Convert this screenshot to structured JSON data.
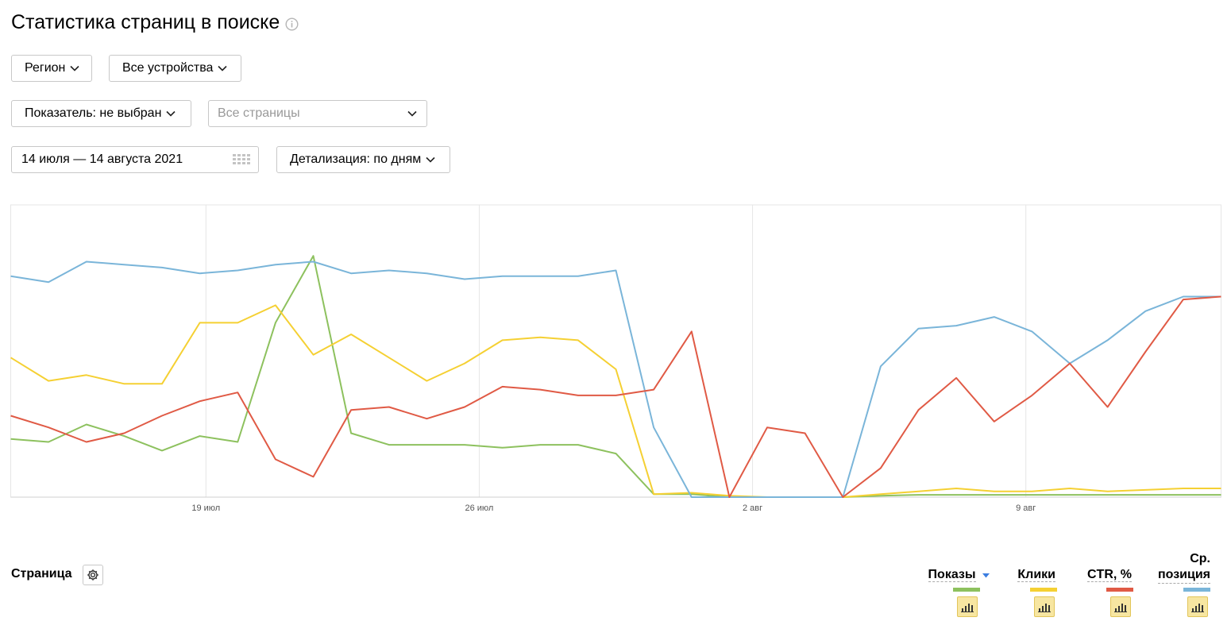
{
  "page": {
    "title": "Статистика страниц в поиске"
  },
  "filters": {
    "region_label": "Регион",
    "devices_label": "Все устройства",
    "indicator_label": "Показатель: не выбран",
    "pages_placeholder": "Все страницы",
    "date_range": "14 июля — 14 августа 2021",
    "detail_label": "Детализация: по дням"
  },
  "table": {
    "page_column_label": "Страница",
    "columns": [
      {
        "label": "Показы",
        "color": "#8dc15e"
      },
      {
        "label": "Клики",
        "color": "#f5d033"
      },
      {
        "label": "CTR, %",
        "color": "#e05a45"
      },
      {
        "label_line1": "Ср.",
        "label_line2": "позиция",
        "color": "#7ab5d9"
      }
    ]
  },
  "chart_data": {
    "type": "line",
    "x_range": [
      "2021-07-14",
      "2021-08-14"
    ],
    "x_ticks": [
      {
        "label": "19 июл",
        "date": "2021-07-19"
      },
      {
        "label": "26 июл",
        "date": "2021-07-26"
      },
      {
        "label": "2 авг",
        "date": "2021-08-02"
      },
      {
        "label": "9 авг",
        "date": "2021-08-09"
      }
    ],
    "y_range": [
      0,
      100
    ],
    "grid": true,
    "series": [
      {
        "name": "Показы",
        "color": "#8dc15e",
        "values": [
          20,
          19,
          25,
          21,
          16,
          21,
          19,
          60,
          83,
          22,
          18,
          18,
          18,
          17,
          18,
          18,
          15,
          1,
          1,
          0,
          0,
          0,
          0,
          0.5,
          0.8,
          0.8,
          0.8,
          0.8,
          0.8,
          0.8,
          0.8,
          0.8,
          0.8
        ]
      },
      {
        "name": "Клики",
        "color": "#f5d033",
        "values": [
          48,
          40,
          42,
          39,
          39,
          60,
          60,
          66,
          49,
          56,
          48,
          40,
          46,
          54,
          55,
          54,
          44,
          1,
          1.5,
          0.5,
          0,
          0,
          0,
          1,
          2,
          3,
          2,
          2,
          3,
          2,
          2.5,
          3,
          3
        ]
      },
      {
        "name": "CTR, %",
        "color": "#e05a45",
        "values": [
          28,
          24,
          19,
          22,
          28,
          33,
          36,
          13,
          7,
          30,
          31,
          27,
          31,
          38,
          37,
          35,
          35,
          37,
          57,
          0,
          24,
          22,
          0,
          10,
          30,
          41,
          26,
          35,
          46,
          31,
          50,
          68,
          69
        ]
      },
      {
        "name": "Ср. позиция",
        "color": "#7ab5d9",
        "values": [
          76,
          74,
          81,
          80,
          79,
          77,
          78,
          80,
          81,
          77,
          78,
          77,
          75,
          76,
          76,
          76,
          78,
          24,
          0,
          0,
          0,
          0,
          0,
          45,
          58,
          59,
          62,
          57,
          46,
          54,
          64,
          69,
          69
        ]
      }
    ]
  }
}
